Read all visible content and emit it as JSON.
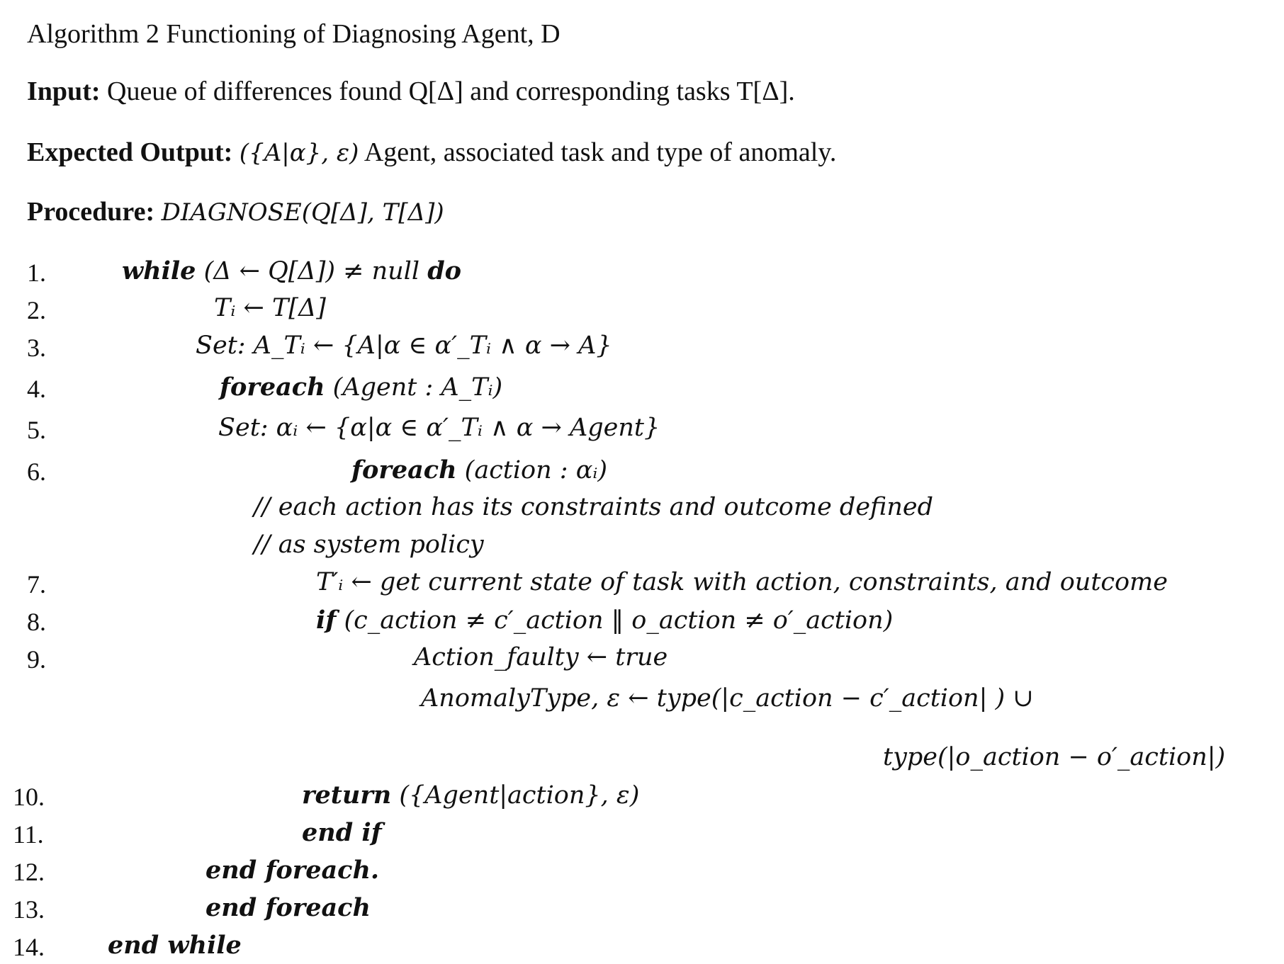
{
  "header": {
    "title": "Algorithm 2 Functioning of Diagnosing Agent, D",
    "input_label": "Input:",
    "input_text": "Queue of differences found Q[Δ] and corresponding tasks T[Δ].",
    "output_label": "Expected Output:",
    "output_math": "({A|α}, ε)",
    "output_text": "Agent, associated task and type of anomaly.",
    "procedure_label": "Procedure:",
    "procedure_text": "DIAGNOSE(Q[Δ], T[Δ])"
  },
  "lines": [
    {
      "num": "1.",
      "kw": "while",
      "text": " (Δ ← Q[Δ])  ≠ null ",
      "kw2": "do"
    },
    {
      "num": "2.",
      "kw": "",
      "text": "Tᵢ ← T[Δ]",
      "kw2": ""
    },
    {
      "num": "3.",
      "kw": "",
      "text": "Set: A_Tᵢ ← {A|α ∈ α′_Tᵢ  ∧  α →  A}",
      "kw2": ""
    },
    {
      "num": "4.",
      "kw": "foreach",
      "text": " (Agent :  A_Tᵢ)",
      "kw2": ""
    },
    {
      "num": "5.",
      "kw": "",
      "text": "Set: αᵢ  ← {α|α ∈ α′_Tᵢ  ∧  α →  Agent}",
      "kw2": ""
    },
    {
      "num": "6.",
      "kw": "foreach",
      "text": " (action :  αᵢ)",
      "kw2": ""
    },
    {
      "num": "",
      "kw": "",
      "text": "// each action has its constraints and outcome defined",
      "kw2": ""
    },
    {
      "num": "",
      "kw": "",
      "text": "// as system policy",
      "kw2": ""
    },
    {
      "num": "7.",
      "kw": "",
      "text": "T′ᵢ ← get current state of task with action, constraints, and outcome",
      "kw2": ""
    },
    {
      "num": "8.",
      "kw": "if",
      "text": " (c_action ≠ c′_action ‖ o_action ≠ o′_action)",
      "kw2": ""
    },
    {
      "num": "9.",
      "kw": "",
      "text": "Action_faulty ←  true",
      "kw2": ""
    },
    {
      "num": "",
      "kw": "",
      "text": "AnomalyType, ε ← type(|c_action − c′_action| ) ∪",
      "kw2": ""
    },
    {
      "num": "",
      "kw": "",
      "text": "type(|o_action − o′_action|)",
      "kw2": ""
    },
    {
      "num": "10.",
      "kw": "return",
      "text": " ({Agent|action}, ε)",
      "kw2": ""
    },
    {
      "num": "11.",
      "kw": "end if",
      "text": "",
      "kw2": ""
    },
    {
      "num": "12.",
      "kw": "end foreach.",
      "text": "",
      "kw2": ""
    },
    {
      "num": "13.",
      "kw": "end foreach",
      "text": "",
      "kw2": ""
    },
    {
      "num": "14.",
      "kw": "end while",
      "text": "",
      "kw2": ""
    }
  ]
}
